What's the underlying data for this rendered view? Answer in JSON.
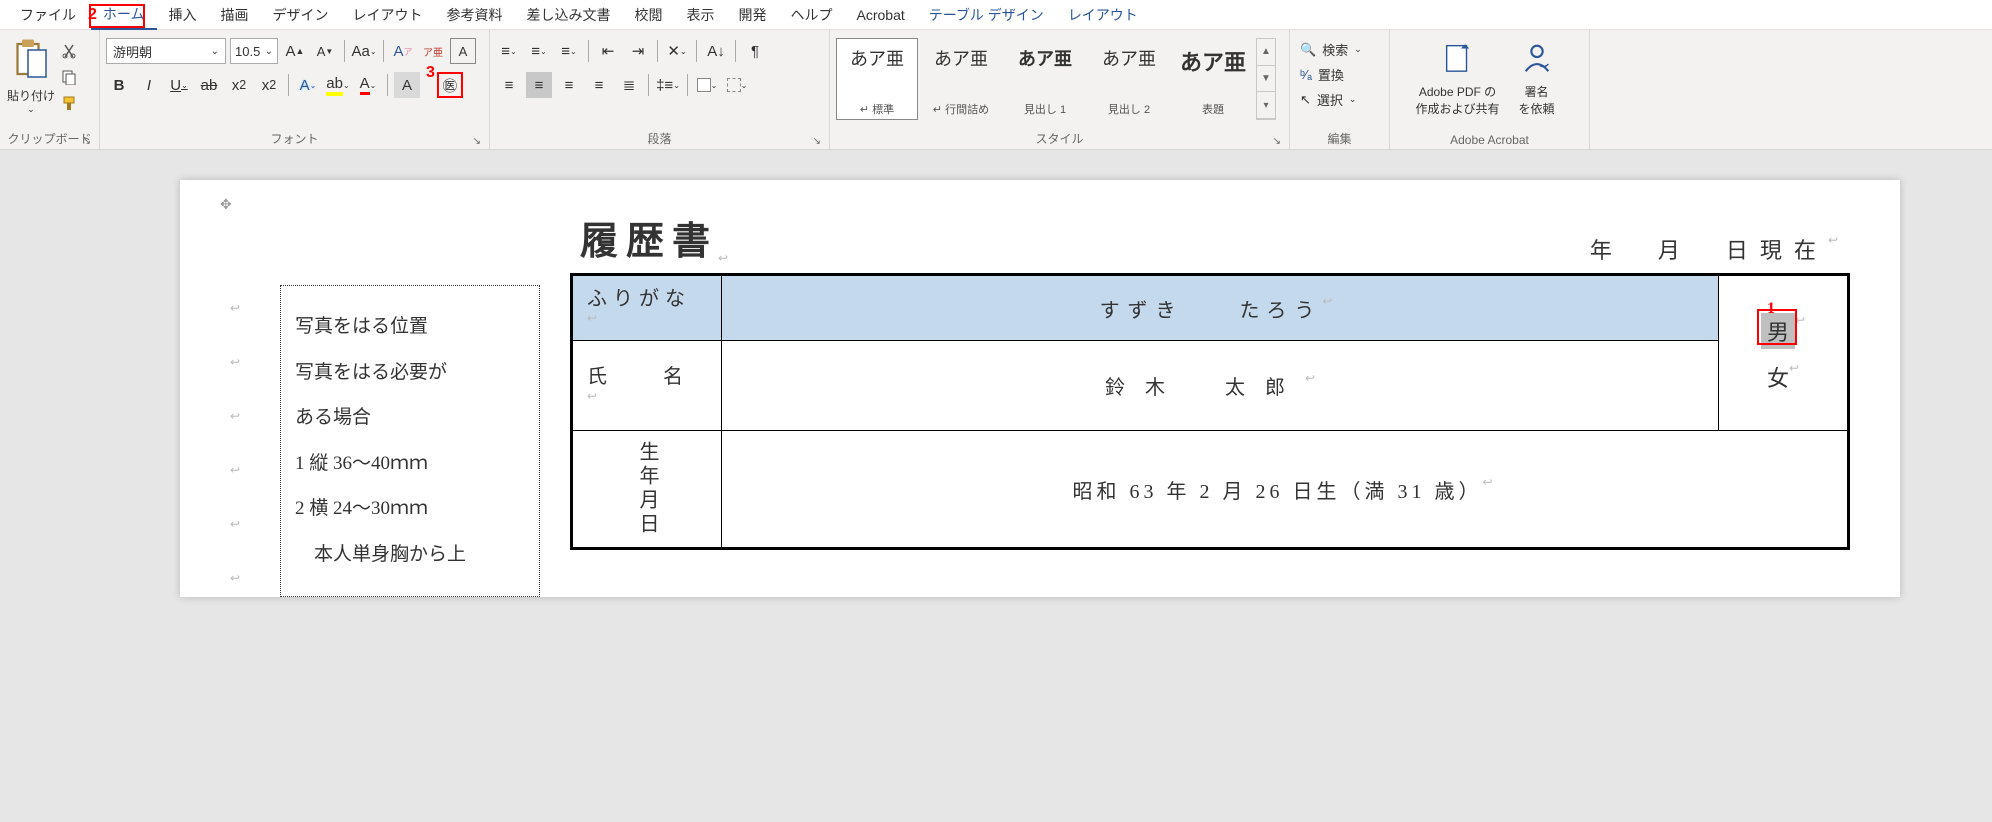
{
  "tabs": {
    "file": "ファイル",
    "home": "ホーム",
    "insert": "挿入",
    "draw": "描画",
    "design": "デザイン",
    "layout": "レイアウト",
    "reference": "参考資料",
    "mailings": "差し込み文書",
    "review": "校閲",
    "view": "表示",
    "dev": "開発",
    "help": "ヘルプ",
    "acrobat": "Acrobat",
    "table_design": "テーブル デザイン",
    "layout2": "レイアウト"
  },
  "ribbon": {
    "clipboard": {
      "paste": "貼り付け",
      "label": "クリップボード"
    },
    "font": {
      "name": "游明朝",
      "size": "10.5",
      "label": "フォント"
    },
    "paragraph": {
      "label": "段落"
    },
    "styles": {
      "label": "スタイル",
      "items": [
        {
          "preview": "あア亜",
          "sub": "↵ 標準"
        },
        {
          "preview": "あア亜",
          "sub": "↵ 行間詰め"
        },
        {
          "preview": "あア亜",
          "sub": "見出し 1"
        },
        {
          "preview": "あア亜",
          "sub": "見出し 2"
        },
        {
          "preview": "あア亜",
          "sub": "表題"
        }
      ]
    },
    "editing": {
      "find": "検索",
      "replace": "置換",
      "select": "選択",
      "label": "編集"
    },
    "acrobat": {
      "pdf": "Adobe PDF の\n作成および共有",
      "sign": "署名\nを依頼",
      "label": "Adobe Acrobat"
    }
  },
  "doc": {
    "title": "履歴書",
    "date": "年　月　日現在",
    "photo": {
      "l1": "写真をはる位置",
      "l2": "写真をはる必要が",
      "l3": "ある場合",
      "l4": "1 縦 36～40ｍｍ",
      "l5": "2 横 24～30ｍｍ",
      "l6": "本人単身胸から上"
    },
    "furigana_label": "ふりがな",
    "furigana": "すずき　　たろう",
    "name_label": "氏　名",
    "name": "鈴木　太郎",
    "male": "男",
    "female": "女",
    "birth_label": "生年月日",
    "birth": "昭和 63 年 2 月 26 日生（満 31 歳）"
  },
  "annot": {
    "n1": "1",
    "n2": "2",
    "n3": "3"
  }
}
